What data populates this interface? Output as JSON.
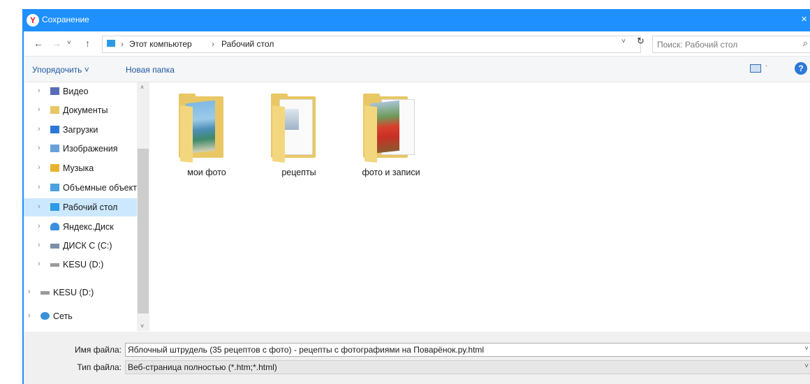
{
  "window": {
    "title": "Сохранение",
    "logo_letter": "Y",
    "close_glyph": "×"
  },
  "nav": {
    "back_glyph": "←",
    "forward_glyph": "→",
    "recent_glyph": "˅",
    "up_glyph": "↑"
  },
  "address": {
    "crumbs": [
      "Этот компьютер",
      "Рабочий стол"
    ],
    "separator": "›",
    "dropdown_glyph": "˅",
    "refresh_glyph": "↻"
  },
  "search": {
    "placeholder": "Поиск: Рабочий стол",
    "icon_glyph": "⌕"
  },
  "toolbar": {
    "organize_label": "Упорядочить ˅",
    "new_folder_label": "Новая папка",
    "help_glyph": "?",
    "view_dd_glyph": "·"
  },
  "sidebar": {
    "scroll_up_glyph": "˄",
    "scroll_down_glyph": "˅",
    "items": [
      {
        "label": "Видео",
        "icon": "video-folder-icon",
        "color": "#5a6cb8"
      },
      {
        "label": "Документы",
        "icon": "documents-folder-icon",
        "color": "#e8c764"
      },
      {
        "label": "Загрузки",
        "icon": "downloads-folder-icon",
        "color": "#2b78d8"
      },
      {
        "label": "Изображения",
        "icon": "pictures-folder-icon",
        "color": "#6aa0d8"
      },
      {
        "label": "Музыка",
        "icon": "music-folder-icon",
        "color": "#e8b430"
      },
      {
        "label": "Объемные объекты",
        "icon": "3d-objects-folder-icon",
        "color": "#4aa0e0"
      },
      {
        "label": "Рабочий стол",
        "icon": "desktop-folder-icon",
        "color": "#2b9be6",
        "selected": true
      },
      {
        "label": "Яндекс.Диск",
        "icon": "yandex-disk-icon",
        "color": "#3a8ee0"
      },
      {
        "label": "ДИСК C (C:)",
        "icon": "drive-c-icon",
        "color": "#7a8fa8"
      },
      {
        "label": "KESU (D:)",
        "icon": "drive-d-icon",
        "color": "#9a9a9a"
      },
      {
        "label": "KESU (D:)",
        "icon": "drive-d-icon",
        "color": "#9a9a9a"
      },
      {
        "label": "Сеть",
        "icon": "network-icon",
        "color": "#3a90d8"
      }
    ],
    "arrow_glyph": "›"
  },
  "content": {
    "folders": [
      {
        "name": "мои фото",
        "preview": "photo-beach"
      },
      {
        "name": "рецепты",
        "preview": "documents"
      },
      {
        "name": "фото и записи",
        "preview": "photo-flowers"
      }
    ]
  },
  "bottom": {
    "filename_label": "Имя файла:",
    "filename_value": "Яблочный штрудель (35 рецептов с фото) - рецепты с фотографиями на Поварёнок.ру.html",
    "filetype_label": "Тип файла:",
    "filetype_value": "Веб-страница полностью (*.htm;*.html)",
    "dropdown_glyph": "˅"
  }
}
